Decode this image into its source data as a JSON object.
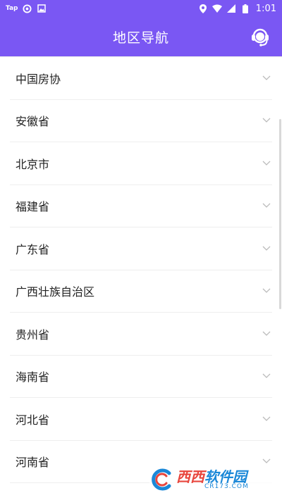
{
  "status_bar": {
    "app_label": "Tap",
    "time": "1:01",
    "icons": [
      "settings-gear-icon",
      "image-icon",
      "location-icon",
      "wifi-icon",
      "cell-signal-icon",
      "battery-icon"
    ]
  },
  "header": {
    "title": "地区导航",
    "support_icon": "customer-service-headset-icon"
  },
  "regions": [
    {
      "label": "中国房协"
    },
    {
      "label": "安徽省"
    },
    {
      "label": "北京市"
    },
    {
      "label": "福建省"
    },
    {
      "label": "广东省"
    },
    {
      "label": "广西壮族自治区"
    },
    {
      "label": "贵州省"
    },
    {
      "label": "海南省"
    },
    {
      "label": "河北省"
    },
    {
      "label": "河南省"
    }
  ],
  "watermark": {
    "brand_red": "西西",
    "brand_blue": "软件园",
    "url": "CR173.COM"
  },
  "colors": {
    "accent": "#7a57f3",
    "chevron": "#bbbbbb",
    "divider": "#eeeeee"
  }
}
